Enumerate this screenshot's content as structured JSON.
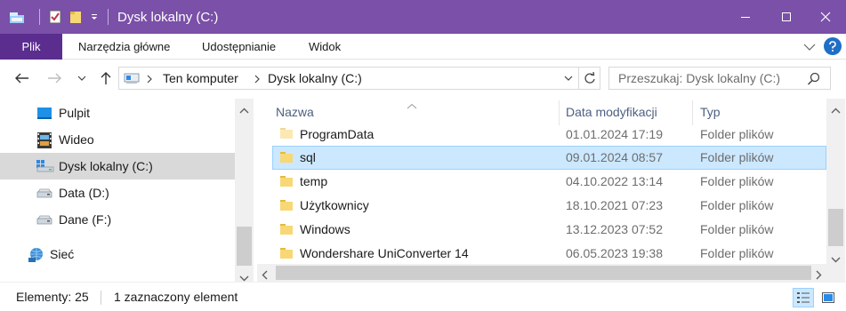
{
  "window": {
    "title": "Dysk lokalny (C:)",
    "titlebar_color": "#7a50a8"
  },
  "ribbon": {
    "tabs": [
      "Plik",
      "Narzędzia główne",
      "Udostępnianie",
      "Widok"
    ],
    "file_tab_color": "#5b2d8e"
  },
  "address": {
    "crumbs": [
      "Ten komputer",
      "Dysk lokalny (C:)"
    ],
    "search_placeholder": "Przeszukaj: Dysk lokalny (C:)"
  },
  "nav": {
    "items": [
      {
        "label": "Pulpit",
        "icon": "desktop-icon"
      },
      {
        "label": "Wideo",
        "icon": "video-icon"
      },
      {
        "label": "Dysk lokalny (C:)",
        "icon": "windows-drive-icon",
        "selected": true
      },
      {
        "label": "Data (D:)",
        "icon": "drive-icon"
      },
      {
        "label": "Dane (F:)",
        "icon": "drive-icon"
      },
      {
        "label": "Sieć",
        "icon": "network-icon"
      }
    ]
  },
  "columns": {
    "name": "Nazwa",
    "date": "Data modyfikacji",
    "type": "Typ"
  },
  "files": [
    {
      "name": "ProgramData",
      "date": "01.01.2024 17:19",
      "type": "Folder plików",
      "faded": true
    },
    {
      "name": "sql",
      "date": "09.01.2024 08:57",
      "type": "Folder plików",
      "selected": true
    },
    {
      "name": "temp",
      "date": "04.10.2022 13:14",
      "type": "Folder plików"
    },
    {
      "name": "Użytkownicy",
      "date": "18.10.2021 07:23",
      "type": "Folder plików"
    },
    {
      "name": "Windows",
      "date": "13.12.2023 07:52",
      "type": "Folder plików"
    },
    {
      "name": "Wondershare UniConverter 14",
      "date": "06.05.2023 19:38",
      "type": "Folder plików"
    }
  ],
  "status": {
    "count": "Elementy: 25",
    "selection": "1 zaznaczony element"
  },
  "colors": {
    "selected_row_bg": "#cce8ff",
    "selected_row_border": "#99d1ff",
    "header_text": "#4d6082",
    "folder_yellow": "#f8d775"
  }
}
